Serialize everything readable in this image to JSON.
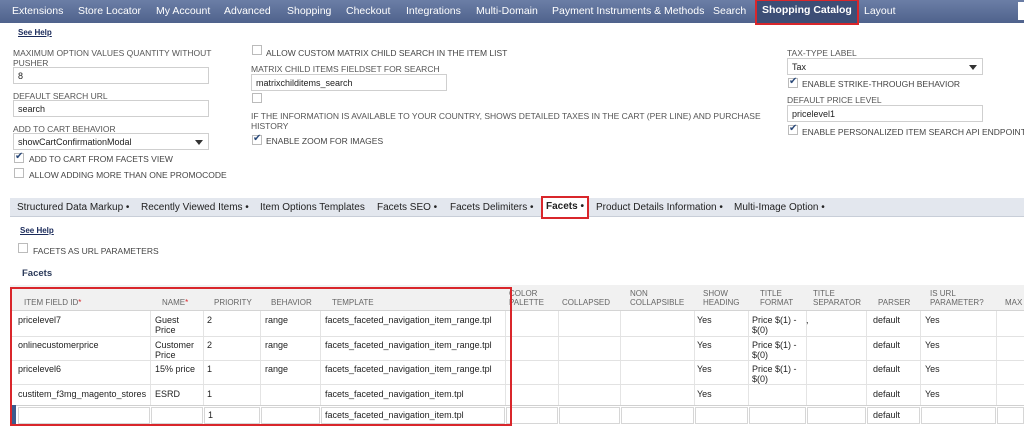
{
  "nav": {
    "items": [
      "Extensions",
      "Store Locator",
      "My Account",
      "Advanced",
      "Shopping",
      "Checkout",
      "Integrations",
      "Multi-Domain",
      "Payment Instruments & Methods",
      "Search",
      "Shopping Catalog",
      "Layout"
    ],
    "active": "Shopping Catalog"
  },
  "settings": {
    "see_help": "See Help",
    "max_option_label": "MAXIMUM OPTION VALUES QUANTITY WITHOUT PUSHER",
    "max_option_value": "8",
    "default_search_url_label": "DEFAULT SEARCH URL",
    "default_search_url_value": "search",
    "add_to_cart_behavior_label": "ADD TO CART BEHAVIOR",
    "add_to_cart_behavior_value": "showCartConfirmationModal",
    "add_to_cart_from_facets": "ADD TO CART FROM FACETS VIEW",
    "allow_more_promocode": "ALLOW ADDING MORE THAN ONE PROMOCODE",
    "allow_custom_matrix": "ALLOW CUSTOM MATRIX CHILD SEARCH IN THE ITEM LIST",
    "matrix_fieldset_label": "MATRIX CHILD ITEMS FIELDSET FOR SEARCH",
    "matrix_fieldset_value": "matrixchilditems_search",
    "taxes_info": "IF THE INFORMATION IS AVAILABLE TO YOUR COUNTRY, SHOWS DETAILED TAXES IN THE CART (PER LINE) AND PURCHASE HISTORY",
    "enable_zoom": "ENABLE ZOOM FOR IMAGES",
    "tax_type_label": "TAX-TYPE LABEL",
    "tax_type_value": "Tax",
    "strike_through": "ENABLE STRIKE-THROUGH BEHAVIOR",
    "default_price_level_label": "DEFAULT PRICE LEVEL",
    "default_price_level_value": "pricelevel1",
    "personalized_search": "ENABLE PERSONALIZED ITEM SEARCH API ENDPOINT"
  },
  "subtabs": {
    "items": [
      "Structured Data Markup •",
      "Recently Viewed Items •",
      "Item Options Templates",
      "Facets SEO •",
      "Facets Delimiters •",
      "Facets •",
      "Product Details Information •",
      "Multi-Image Option •"
    ],
    "active": "Facets •"
  },
  "facets_panel": {
    "see_help": "See Help",
    "facets_as_url": "FACETS AS URL PARAMETERS",
    "title": "Facets"
  },
  "table": {
    "headers": {
      "item_field_id": "ITEM FIELD ID",
      "name": "NAME",
      "priority": "PRIORITY",
      "behavior": "BEHAVIOR",
      "template": "TEMPLATE",
      "color_palette": "COLOR PALETTE",
      "collapsed": "COLLAPSED",
      "non_collapsible": "NON COLLAPSIBLE",
      "show_heading": "SHOW HEADING",
      "title_format": "TITLE FORMAT",
      "title_separator": "TITLE SEPARATOR",
      "parser": "PARSER",
      "is_url_parameter": "IS URL PARAMETER?",
      "max": "MAX",
      "required_mark": "*"
    },
    "rows": [
      {
        "item_field_id": "pricelevel7",
        "name": "Guest Price",
        "priority": "2",
        "behavior": "range",
        "template": "facets_faceted_navigation_item_range.tpl",
        "show_heading": "Yes",
        "title_format": "Price $(1) - $(0)",
        "title_separator": ",",
        "parser": "default",
        "is_url_parameter": "Yes"
      },
      {
        "item_field_id": "onlinecustomerprice",
        "name": "Customer Price",
        "priority": "2",
        "behavior": "range",
        "template": "facets_faceted_navigation_item_range.tpl",
        "show_heading": "Yes",
        "title_format": "Price $(1) - $(0)",
        "title_separator": "",
        "parser": "default",
        "is_url_parameter": "Yes"
      },
      {
        "item_field_id": "pricelevel6",
        "name": "15% price",
        "priority": "1",
        "behavior": "range",
        "template": "facets_faceted_navigation_item_range.tpl",
        "show_heading": "Yes",
        "title_format": "Price $(1) - $(0)",
        "title_separator": "",
        "parser": "default",
        "is_url_parameter": "Yes"
      },
      {
        "item_field_id": "custitem_f3mg_magento_stores",
        "name": "ESRD",
        "priority": "1",
        "behavior": "",
        "template": "facets_faceted_navigation_item.tpl",
        "show_heading": "Yes",
        "title_format": "",
        "title_separator": "",
        "parser": "default",
        "is_url_parameter": "Yes"
      }
    ],
    "new_row": {
      "priority": "1",
      "template": "facets_faceted_navigation_item.tpl",
      "parser": "default"
    }
  }
}
